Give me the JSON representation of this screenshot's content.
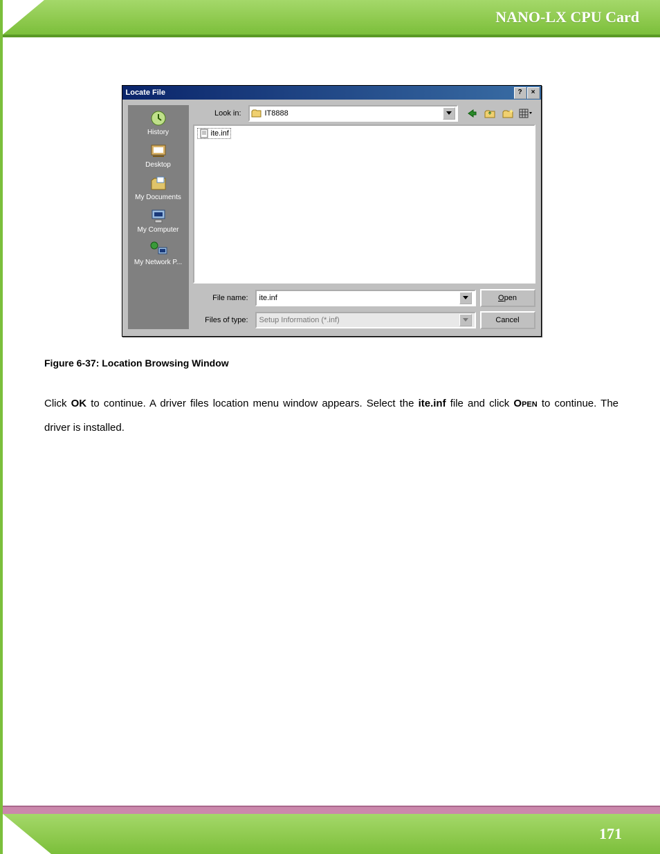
{
  "header": {
    "title": "NANO-LX CPU Card"
  },
  "footer": {
    "page_number": "171"
  },
  "dialog": {
    "title": "Locate File",
    "help_glyph": "?",
    "close_glyph": "×",
    "look_in_label": "Look in:",
    "look_in_value": "IT8888",
    "places": [
      {
        "key": "history",
        "label": "History"
      },
      {
        "key": "desktop",
        "label": "Desktop"
      },
      {
        "key": "mydocs",
        "label": "My Documents"
      },
      {
        "key": "mycomp",
        "label": "My Computer"
      },
      {
        "key": "mynet",
        "label": "My Network P..."
      }
    ],
    "file_item": "ite.inf",
    "file_name_label": "File name:",
    "file_name_value": "ite.inf",
    "file_type_label": "Files of type:",
    "file_type_value": "Setup Information (*.inf)",
    "open_label": "Open",
    "cancel_label": "Cancel"
  },
  "caption": "Figure 6-37: Location Browsing Window",
  "body": {
    "pre_ok": "Click ",
    "ok": "OK",
    "mid1": " to continue. A driver files location menu window appears. Select the ",
    "iteinf": "ite.inf",
    "mid2": " file and click ",
    "open": "Open",
    "tail": " to continue. The driver is installed."
  }
}
